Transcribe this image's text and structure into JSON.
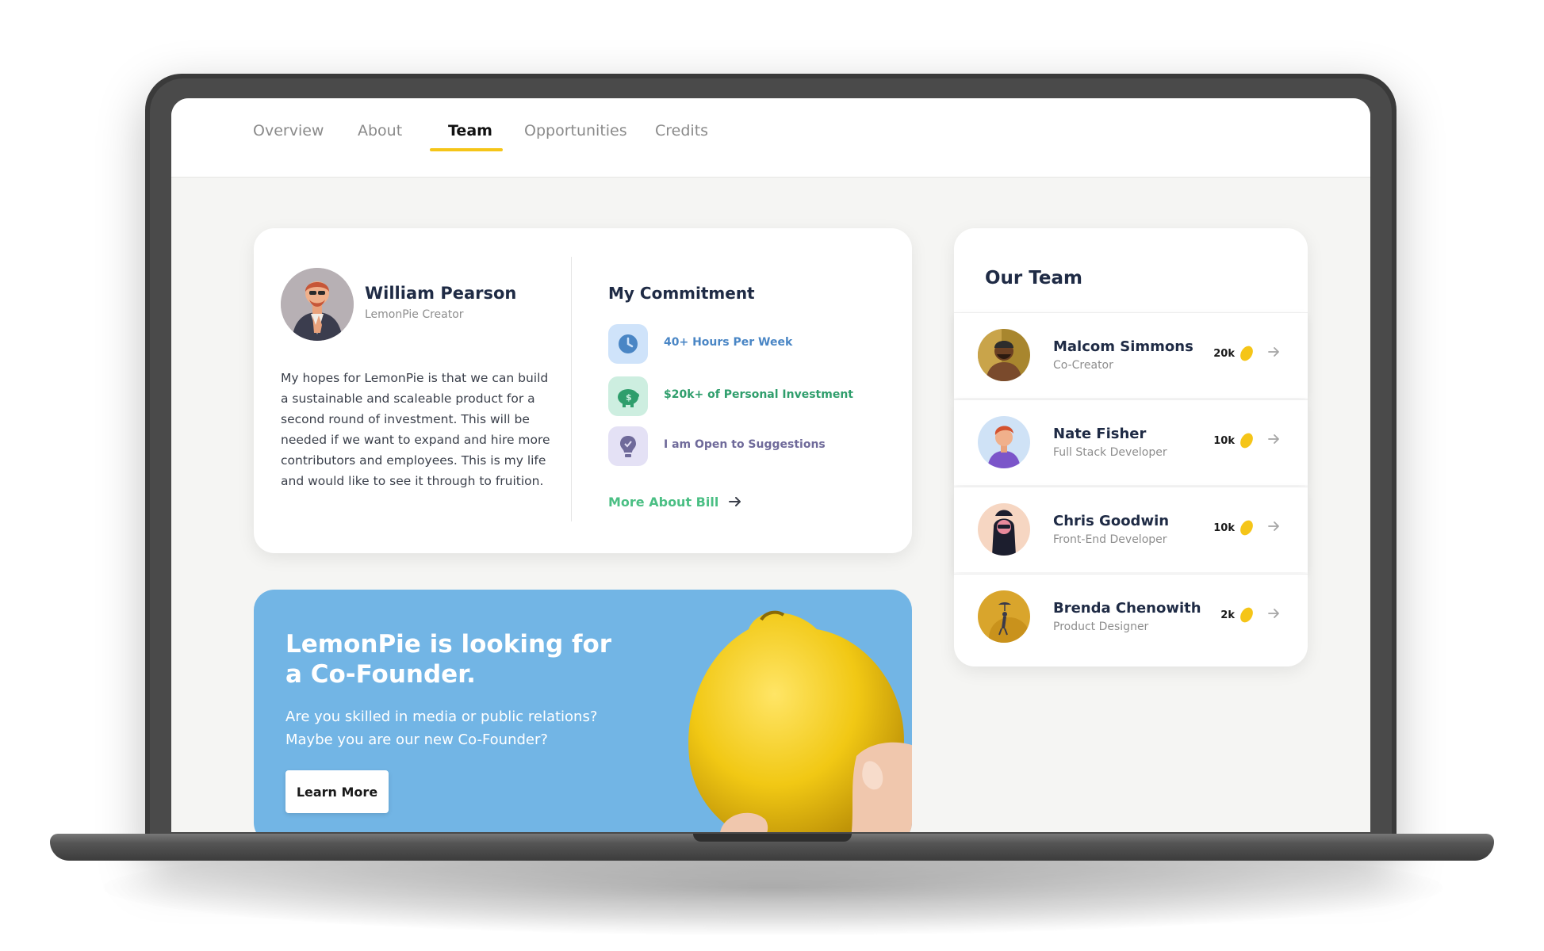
{
  "nav": {
    "tabs": [
      {
        "label": "Overview"
      },
      {
        "label": "About"
      },
      {
        "label": "Team"
      },
      {
        "label": "Opportunities"
      },
      {
        "label": "Credits"
      }
    ],
    "active_tab": "Team"
  },
  "profile": {
    "name": "William Pearson",
    "role": "LemonPie Creator",
    "bio": "My hopes for LemonPie is that we can build a sustainable and scaleable product for a second round of investment. This will be needed if we want to expand and hire more contributors and employees. This is my life and would like to see it through to fruition."
  },
  "commitment": {
    "title": "My Commitment",
    "items": [
      {
        "label": "40+ Hours Per Week",
        "icon": "clock-icon",
        "color": "#4a86c5",
        "bg": "#cfe3fa"
      },
      {
        "label": "$20k+ of Personal Investment",
        "icon": "piggy-bank-icon",
        "color": "#2f9e6c",
        "bg": "#cdeee0"
      },
      {
        "label": "I am Open to Suggestions",
        "icon": "lightbulb-icon",
        "color": "#6f6a9a",
        "bg": "#e4e1f5"
      }
    ],
    "more_link": "More About Bill"
  },
  "promo": {
    "title": "LemonPie is looking for a Co-Founder.",
    "text": "Are you skilled in media or public relations? Maybe you are our new Co-Founder?",
    "button": "Learn More"
  },
  "team": {
    "title": "Our Team",
    "members": [
      {
        "name": "Malcom Simmons",
        "role": "Co-Creator",
        "credits": "20k"
      },
      {
        "name": "Nate Fisher",
        "role": "Full Stack Developer",
        "credits": "10k"
      },
      {
        "name": "Chris Goodwin",
        "role": "Front-End Developer",
        "credits": "10k"
      },
      {
        "name": "Brenda Chenowith",
        "role": "Product Designer",
        "credits": "2k"
      }
    ]
  },
  "colors": {
    "accent_yellow": "#f5c518",
    "link_green": "#4bbf84",
    "promo_blue": "#72b5e5",
    "heading_navy": "#1f2b45"
  }
}
